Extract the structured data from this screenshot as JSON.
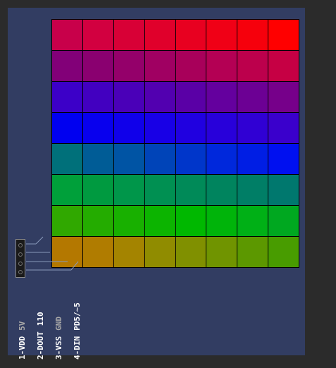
{
  "window": {
    "background": "#2b2b2b",
    "board_color": "#323d62"
  },
  "matrix": {
    "rows": [
      [
        "#c8004a",
        "#d20040",
        "#d80036",
        "#e0002b",
        "#e80020",
        "#f00016",
        "#f6000c",
        "#ff0000"
      ],
      [
        "#820078",
        "#8a0070",
        "#94006a",
        "#a00062",
        "#a8005a",
        "#b40054",
        "#bc004c",
        "#c60044"
      ],
      [
        "#3c00c8",
        "#4200c0",
        "#4a00b8",
        "#5200b0",
        "#5a00a6",
        "#64009e",
        "#6c0094",
        "#76008a"
      ],
      [
        "#0000f0",
        "#0800ee",
        "#1000ea",
        "#1800e6",
        "#2000e0",
        "#2800da",
        "#3000d4",
        "#3a00cc"
      ],
      [
        "#00707a",
        "#005c96",
        "#0054a4",
        "#0044b8",
        "#0036ca",
        "#0028dc",
        "#001ee4",
        "#0010f0"
      ],
      [
        "#00a03a",
        "#009a40",
        "#00964a",
        "#009052",
        "#008a58",
        "#00845e",
        "#007e66",
        "#00786e"
      ],
      [
        "#30a800",
        "#24ac00",
        "#18b000",
        "#0cb400",
        "#00b800",
        "#00b40a",
        "#00b016",
        "#00a820"
      ],
      [
        "#b47800",
        "#b07c00",
        "#a48400",
        "#908c00",
        "#809000",
        "#709400",
        "#5c9800",
        "#489c00"
      ]
    ]
  },
  "pins": [
    {
      "name": "1-VDD",
      "signal": "5V",
      "bright": false
    },
    {
      "name": "2-DOUT",
      "signal": "110",
      "bright": true
    },
    {
      "name": "3-VSS",
      "signal": "GND",
      "bright": false
    },
    {
      "name": "4-DIN",
      "signal": "PD5/~5",
      "bright": true
    }
  ]
}
